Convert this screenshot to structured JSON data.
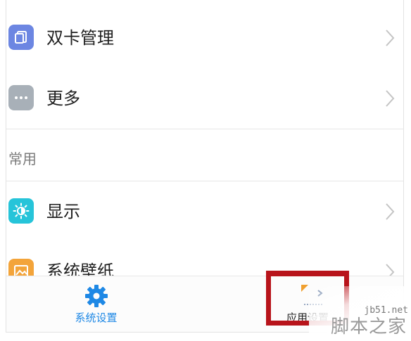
{
  "settings_list": {
    "items": [
      {
        "label": "双卡管理",
        "icon": "sim-card-icon",
        "icon_color": "#6c86e2"
      },
      {
        "label": "更多",
        "icon": "more-dots-icon",
        "icon_color": "#a8b0b8"
      }
    ],
    "section_header": "常用",
    "common_items": [
      {
        "label": "显示",
        "icon": "brightness-icon",
        "icon_color": "#26c4d9"
      },
      {
        "label": "系统壁纸",
        "icon": "wallpaper-icon",
        "icon_color": "#f3a43a"
      }
    ]
  },
  "tabbar": {
    "tabs": [
      {
        "label": "系统设置",
        "icon": "gear-icon",
        "active": true
      },
      {
        "label": "应用设置",
        "icon": "apps-icon",
        "active": false
      }
    ],
    "active_color": "#1e88e5"
  },
  "annotation": {
    "color": "#b8141b"
  },
  "watermark": {
    "url": "jb51.net",
    "name": "脚本之家"
  }
}
